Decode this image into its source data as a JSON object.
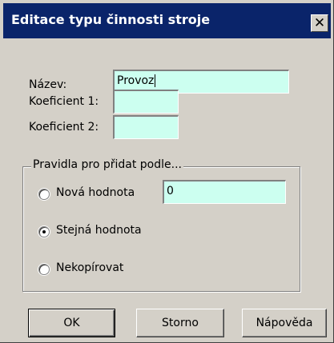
{
  "window": {
    "title": "Editace typu činnosti stroje",
    "close_glyph": "✕"
  },
  "form": {
    "nazev_label": "Název:",
    "nazev_value": "Provoz",
    "koef1_label": "Koeficient 1:",
    "koef1_value": "",
    "koef2_label": "Koeficient 2:",
    "koef2_value": ""
  },
  "rules": {
    "legend": "Pravidla pro přidat podle...",
    "options": [
      {
        "label": "Nová hodnota",
        "checked": false
      },
      {
        "label": "Stejná hodnota",
        "checked": true
      },
      {
        "label": "Nekopírovat",
        "checked": false
      }
    ],
    "new_value": "0"
  },
  "buttons": {
    "ok": "OK",
    "cancel": "Storno",
    "help": "Nápověda"
  },
  "colors": {
    "titlebar": "#0a246a",
    "input_bg": "#ccfff0",
    "face": "#d4d0c8"
  },
  "icons": {
    "close": "close-icon"
  }
}
